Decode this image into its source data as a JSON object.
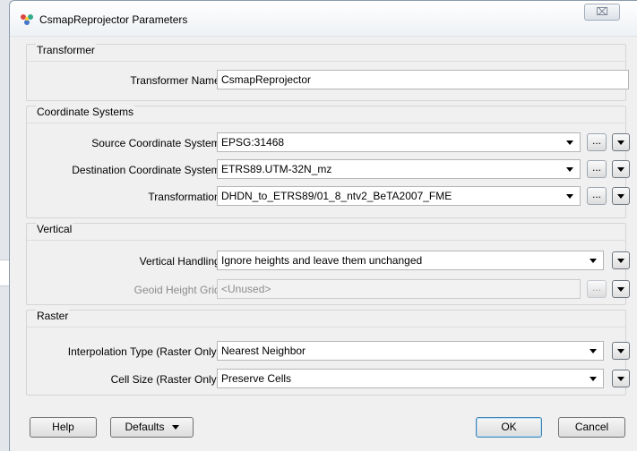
{
  "window": {
    "title": "CsmapReprojector Parameters",
    "close_glyph": "⌧"
  },
  "groups": {
    "transformer": {
      "title": "Transformer",
      "name_label": "Transformer Name:",
      "name_value": "CsmapReprojector"
    },
    "coord": {
      "title": "Coordinate Systems",
      "source_label": "Source Coordinate System:",
      "source_value": "EPSG:31468",
      "dest_label": "Destination Coordinate System:",
      "dest_value": "ETRS89.UTM-32N_mz",
      "trans_label": "Transformation:",
      "trans_value": "DHDN_to_ETRS89/01_8_ntv2_BeTA2007_FME"
    },
    "vertical": {
      "title": "Vertical",
      "handling_label": "Vertical Handling:",
      "handling_value": "Ignore heights and leave them unchanged",
      "geoid_label": "Geoid Height Grid:",
      "geoid_value": "<Unused>"
    },
    "raster": {
      "title": "Raster",
      "interp_label": "Interpolation Type (Raster Only):",
      "interp_value": "Nearest Neighbor",
      "cell_label": "Cell Size (Raster Only):",
      "cell_value": "Preserve Cells"
    }
  },
  "ellipsis": "...",
  "buttons": {
    "help": "Help",
    "defaults": "Defaults",
    "ok": "OK",
    "cancel": "Cancel"
  }
}
